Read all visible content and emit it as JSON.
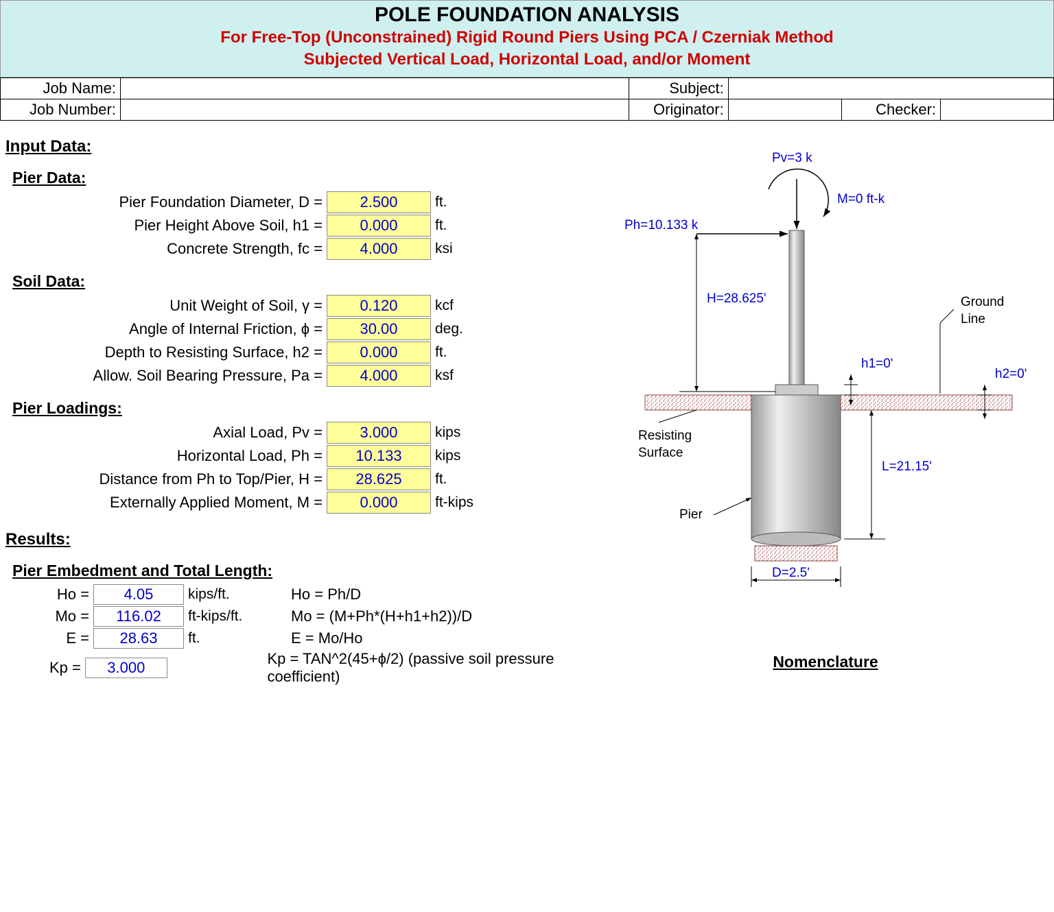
{
  "title": "POLE FOUNDATION ANALYSIS",
  "subtitle1": "For Free-Top (Unconstrained) Rigid Round Piers Using PCA / Czerniak Method",
  "subtitle2": "Subjected Vertical Load, Horizontal Load, and/or Moment",
  "job": {
    "name_lbl": "Job Name:",
    "name_val": "",
    "number_lbl": "Job Number:",
    "number_val": "",
    "subject_lbl": "Subject:",
    "subject_val": "",
    "originator_lbl": "Originator:",
    "originator_val": "",
    "checker_lbl": "Checker:",
    "checker_val": ""
  },
  "headings": {
    "input": "Input Data:",
    "pier_data": "Pier Data:",
    "soil_data": "Soil Data:",
    "pier_loadings": "Pier Loadings:",
    "results": "Results:",
    "embedment": "Pier Embedment and Total Length:",
    "nomenclature": "Nomenclature"
  },
  "inputs": {
    "D": {
      "label": "Pier Foundation Diameter, D =",
      "value": "2.500",
      "unit": "ft."
    },
    "h1": {
      "label": "Pier Height Above Soil, h1 =",
      "value": "0.000",
      "unit": "ft."
    },
    "fc": {
      "label": "Concrete Strength, fc =",
      "value": "4.000",
      "unit": "ksi"
    },
    "gamma": {
      "label": "Unit Weight of Soil, γ =",
      "value": "0.120",
      "unit": "kcf"
    },
    "phi": {
      "label": "Angle of Internal Friction, ϕ =",
      "value": "30.00",
      "unit": "deg."
    },
    "h2": {
      "label": "Depth to Resisting Surface, h2 =",
      "value": "0.000",
      "unit": "ft."
    },
    "Pa": {
      "label": "Allow. Soil Bearing Pressure, Pa =",
      "value": "4.000",
      "unit": "ksf"
    },
    "Pv": {
      "label": "Axial Load, Pv =",
      "value": "3.000",
      "unit": "kips"
    },
    "Ph": {
      "label": "Horizontal Load, Ph =",
      "value": "10.133",
      "unit": "kips"
    },
    "H": {
      "label": "Distance from Ph to Top/Pier, H =",
      "value": "28.625",
      "unit": "ft."
    },
    "M": {
      "label": "Externally Applied Moment, M =",
      "value": "0.000",
      "unit": "ft-kips"
    }
  },
  "results": {
    "Ho": {
      "label": "Ho =",
      "value": "4.05",
      "unit": "kips/ft.",
      "formula": "Ho = Ph/D"
    },
    "Mo": {
      "label": "Mo =",
      "value": "116.02",
      "unit": "ft-kips/ft.",
      "formula": "Mo = (M+Ph*(H+h1+h2))/D"
    },
    "E": {
      "label": "E =",
      "value": "28.63",
      "unit": "ft.",
      "formula": "E = Mo/Ho"
    },
    "Kp": {
      "label": "Kp =",
      "value": "3.000",
      "unit": "",
      "formula": "Kp = TAN^2(45+ϕ/2)  (passive soil pressure coefficient)"
    }
  },
  "diagram": {
    "Pv": "Pv=3 k",
    "M": "M=0 ft-k",
    "Ph": "Ph=10.133 k",
    "H": "H=28.625'",
    "h1": "h1=0'",
    "h2": "h2=0'",
    "L": "L=21.15'",
    "D": "D=2.5'",
    "ground": "Ground",
    "line": "Line",
    "resisting": "Resisting",
    "surface": "Surface",
    "pier": "Pier"
  }
}
